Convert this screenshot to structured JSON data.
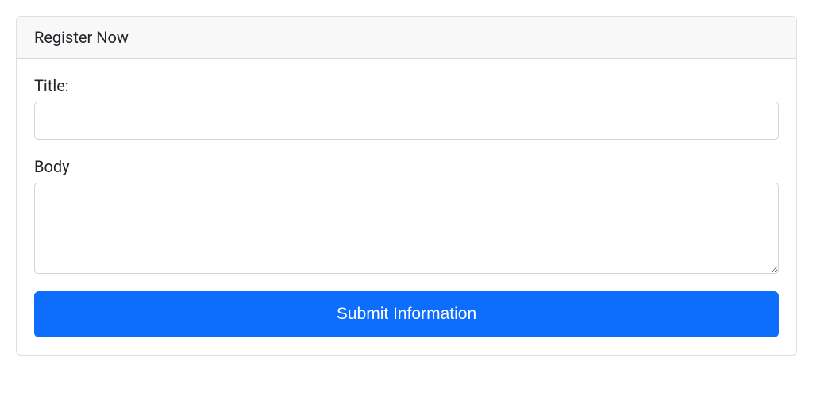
{
  "card": {
    "header": "Register Now"
  },
  "form": {
    "title": {
      "label": "Title:",
      "value": ""
    },
    "body": {
      "label": "Body",
      "value": ""
    },
    "submit_label": "Submit Information"
  }
}
